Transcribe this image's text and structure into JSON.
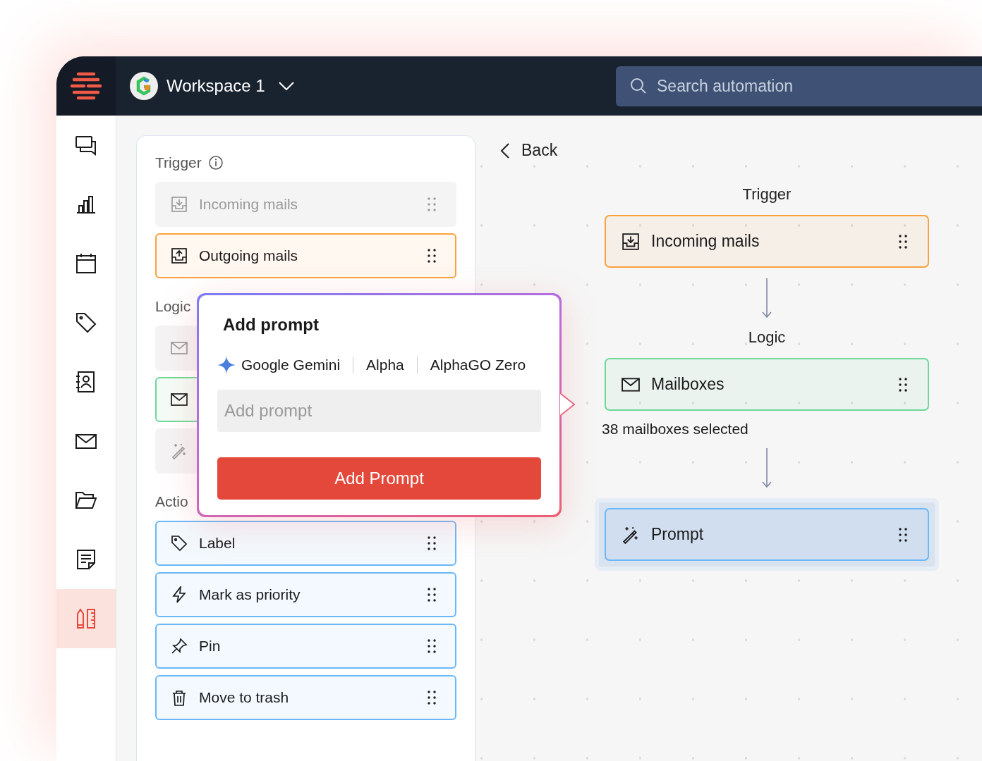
{
  "header": {
    "workspace": "Workspace 1",
    "search": {
      "placeholder": "Search automation"
    }
  },
  "sidebar": {
    "items": [
      {
        "kind": "chat",
        "selected": false
      },
      {
        "kind": "chart",
        "selected": false
      },
      {
        "kind": "calendar",
        "selected": false
      },
      {
        "kind": "tag",
        "selected": false
      },
      {
        "kind": "contact",
        "selected": false
      },
      {
        "kind": "mail",
        "selected": false
      },
      {
        "kind": "folder",
        "selected": false
      },
      {
        "kind": "note",
        "selected": false
      },
      {
        "kind": "tools",
        "selected": true
      }
    ]
  },
  "panel": {
    "sections": [
      {
        "title": "Trigger",
        "info": true,
        "color": "#f9a23f",
        "items": [
          {
            "kind": "download",
            "label": "Incoming mails",
            "disabled": true,
            "selected": false
          },
          {
            "kind": "upload",
            "label": "Outgoing mails",
            "disabled": false,
            "selected": true
          }
        ]
      },
      {
        "title": "Logic",
        "info": false,
        "color": "#6fd89a",
        "items": [
          {
            "kind": "mail",
            "disabled": true,
            "selected": false
          },
          {
            "kind": "mail",
            "disabled": false,
            "selected": true
          },
          {
            "kind": "wand",
            "disabled": true,
            "selected": false
          }
        ]
      },
      {
        "title": "Actio",
        "info": false,
        "color": "#6ab8f7",
        "items": [
          {
            "kind": "tag",
            "label": "Label",
            "disabled": false,
            "selected": true
          },
          {
            "kind": "bolt",
            "label": "Mark as priority",
            "disabled": false,
            "selected": true
          },
          {
            "kind": "pin",
            "label": "Pin",
            "disabled": false,
            "selected": true
          },
          {
            "kind": "trash",
            "label": "Move to trash",
            "disabled": false,
            "selected": true
          }
        ]
      }
    ]
  },
  "popup": {
    "title": "Add prompt",
    "models": [
      "Google Gemini",
      "Alpha",
      "AlphaGO Zero"
    ],
    "field": {
      "placeholder": "Add prompt"
    },
    "button": "Add Prompt"
  },
  "canvas": {
    "back": "Back",
    "flow": [
      {
        "kind": "label",
        "text": "Trigger"
      },
      {
        "kind": "node",
        "label": "Incoming mails",
        "color": "#f9a23f",
        "selected": false
      },
      {
        "kind": "arrow"
      },
      {
        "kind": "label",
        "text": "Logic"
      },
      {
        "kind": "node",
        "label": "Mailboxes",
        "color": "#6fd89a",
        "selected": false
      },
      {
        "kind": "note",
        "text": "38 mailboxes selected"
      },
      {
        "kind": "arrow"
      },
      {
        "kind": "node",
        "label": "Prompt",
        "color": "#6ab8f7",
        "selected": true
      }
    ]
  }
}
